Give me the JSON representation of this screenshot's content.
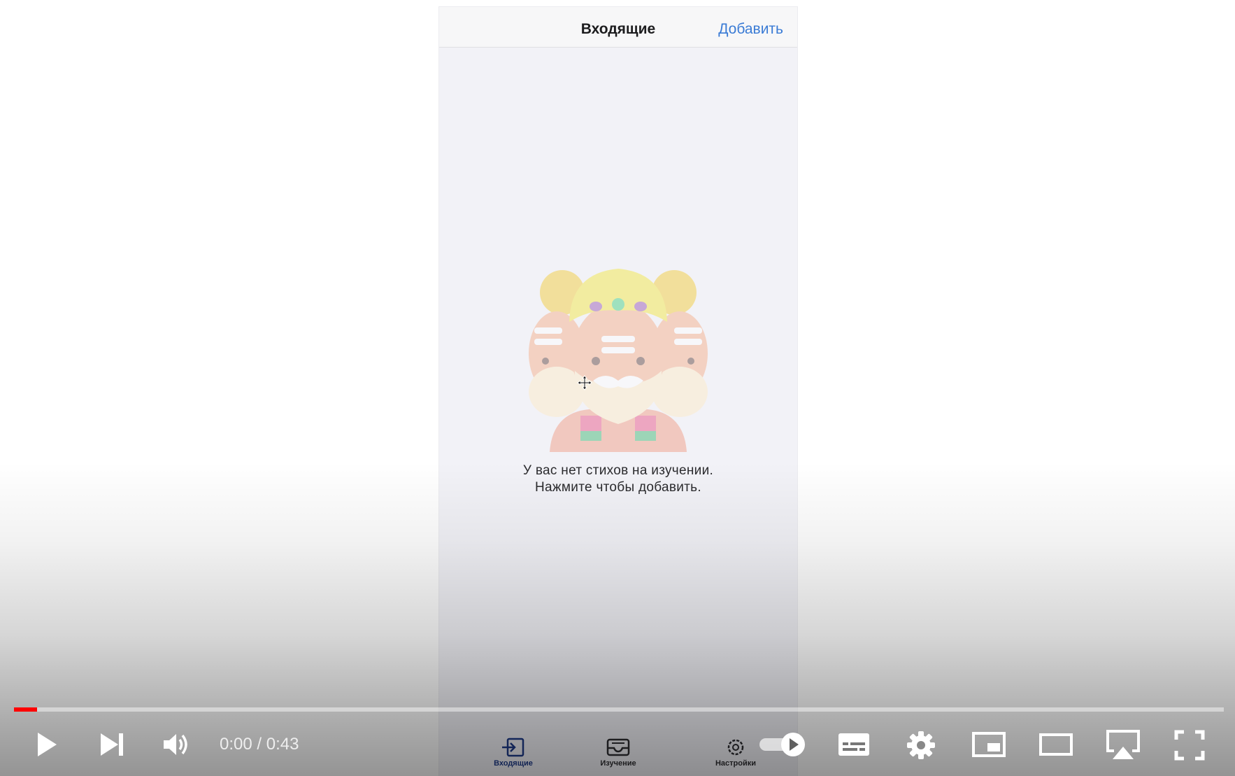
{
  "app": {
    "nav_title": "Входящие",
    "add_label": "Добавить",
    "empty_line1": "У вас нет стихов на изучении.",
    "empty_line2": "Нажмите чтобы добавить.",
    "tabs": [
      {
        "label": "Входящие",
        "icon": "inbox-icon",
        "active": true
      },
      {
        "label": "Изучение",
        "icon": "tray-icon",
        "active": false
      },
      {
        "label": "Настройки",
        "icon": "gear-icon",
        "active": false
      }
    ],
    "accent_color": "#3a7bd5",
    "illustration": "three-faced-sage-illustration"
  },
  "player": {
    "current_time": "0:00",
    "separator": " / ",
    "duration": "0:43",
    "progress_fraction": 0.019,
    "progress_color": "#ff0000",
    "autoplay_on": true,
    "controls": [
      "play-icon",
      "next-icon",
      "volume-icon",
      "autoplay-toggle",
      "subtitles-icon",
      "settings-gear-icon",
      "miniplayer-icon",
      "theater-icon",
      "airplay-icon",
      "fullscreen-icon"
    ]
  }
}
